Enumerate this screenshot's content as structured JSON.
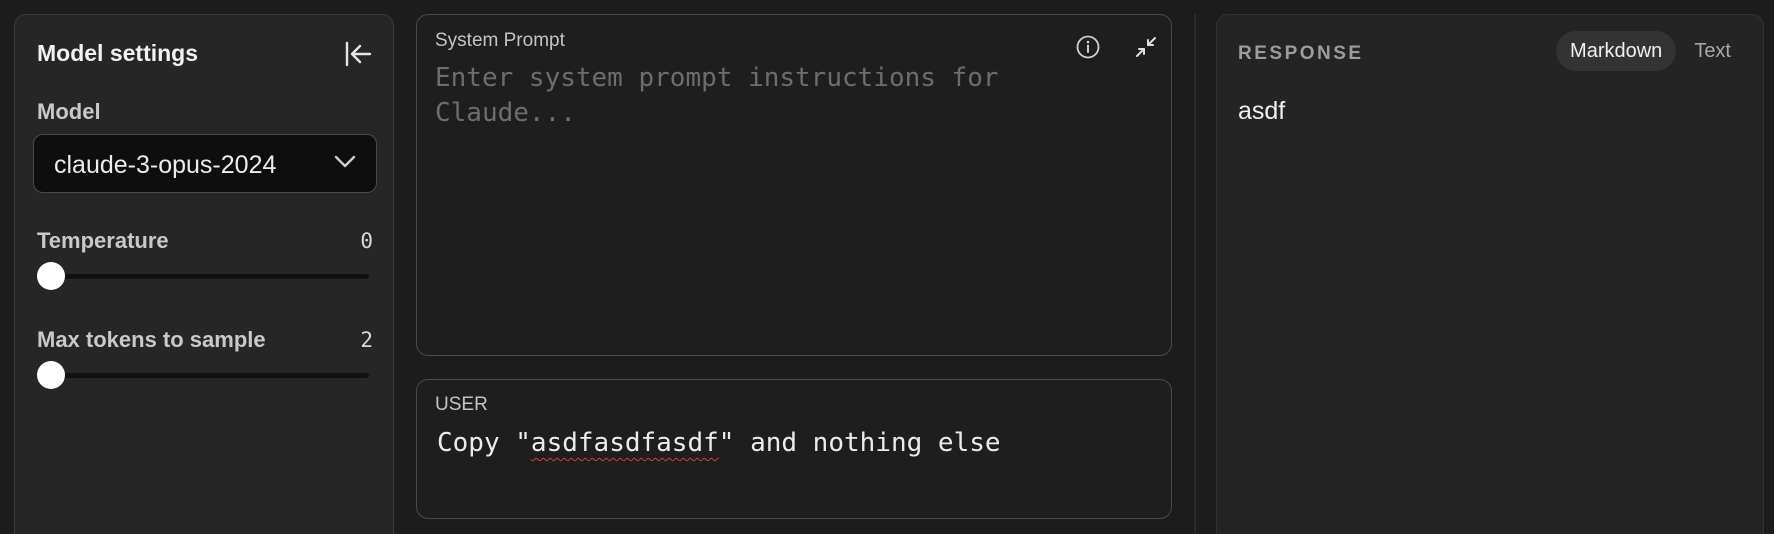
{
  "settings": {
    "title": "Model settings",
    "model_label": "Model",
    "model_value": "claude-3-opus-2024",
    "temperature": {
      "label": "Temperature",
      "value": "0",
      "fraction": 0
    },
    "max_tokens": {
      "label": "Max tokens to sample",
      "value": "2",
      "fraction": 0
    }
  },
  "system_prompt": {
    "label": "System Prompt",
    "placeholder": "Enter system prompt instructions for Claude...",
    "value": "",
    "info_icon": "info-icon",
    "collapse_icon": "minimize-icon"
  },
  "user": {
    "label": "USER",
    "text_before": "Copy \"",
    "text_flagged": "asdfasdfasdf",
    "text_after": "\" and nothing else"
  },
  "response": {
    "title": "RESPONSE",
    "formats": [
      "Markdown",
      "Text"
    ],
    "active_format": "Markdown",
    "text": "asdf"
  },
  "colors": {
    "background": "#1c1c1c",
    "panel": "#262626",
    "spellcheck": "#d43c3c"
  }
}
